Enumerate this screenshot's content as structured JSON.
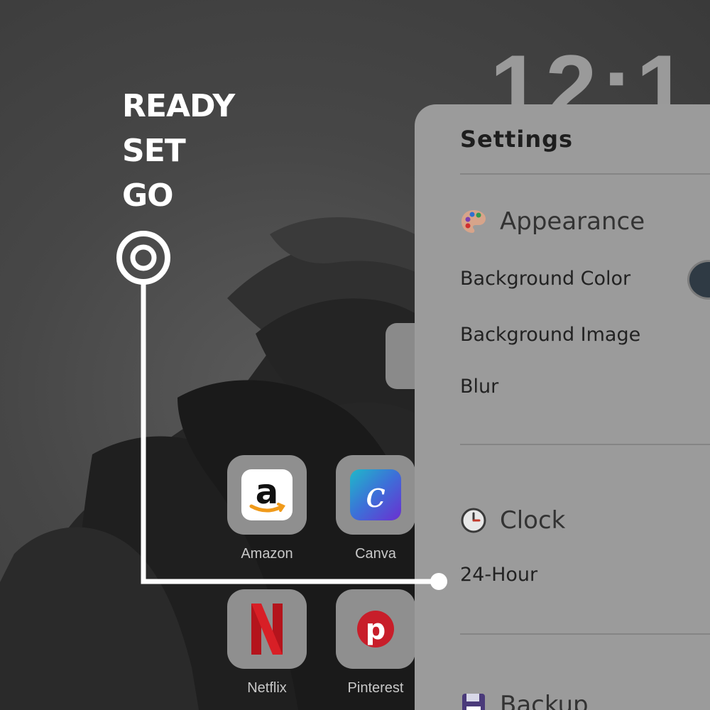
{
  "page": {
    "tagline": [
      "READY",
      "SET",
      "GO"
    ],
    "clock_text": "12:1"
  },
  "shortcuts": [
    {
      "label": "Amazon",
      "icon": "amazon-icon"
    },
    {
      "label": "Canva",
      "icon": "canva-icon"
    },
    {
      "label": "Netflix",
      "icon": "netflix-icon"
    },
    {
      "label": "Pinterest",
      "icon": "pinterest-icon"
    }
  ],
  "settings_panel": {
    "title": "Settings",
    "sections": [
      {
        "title": "Appearance",
        "icon": "palette-icon",
        "items": [
          "Background Color",
          "Background Image",
          "Blur"
        ]
      },
      {
        "title": "Clock",
        "icon": "clock-icon",
        "items": [
          "24-Hour"
        ]
      },
      {
        "title": "Backup",
        "icon": "save-icon",
        "items": []
      }
    ],
    "background_color_value": "#2f3a44"
  },
  "colors": {
    "callout": "#ffffff",
    "overlay_panel": "#9b9b9b",
    "tile": "#8f8f8f"
  }
}
